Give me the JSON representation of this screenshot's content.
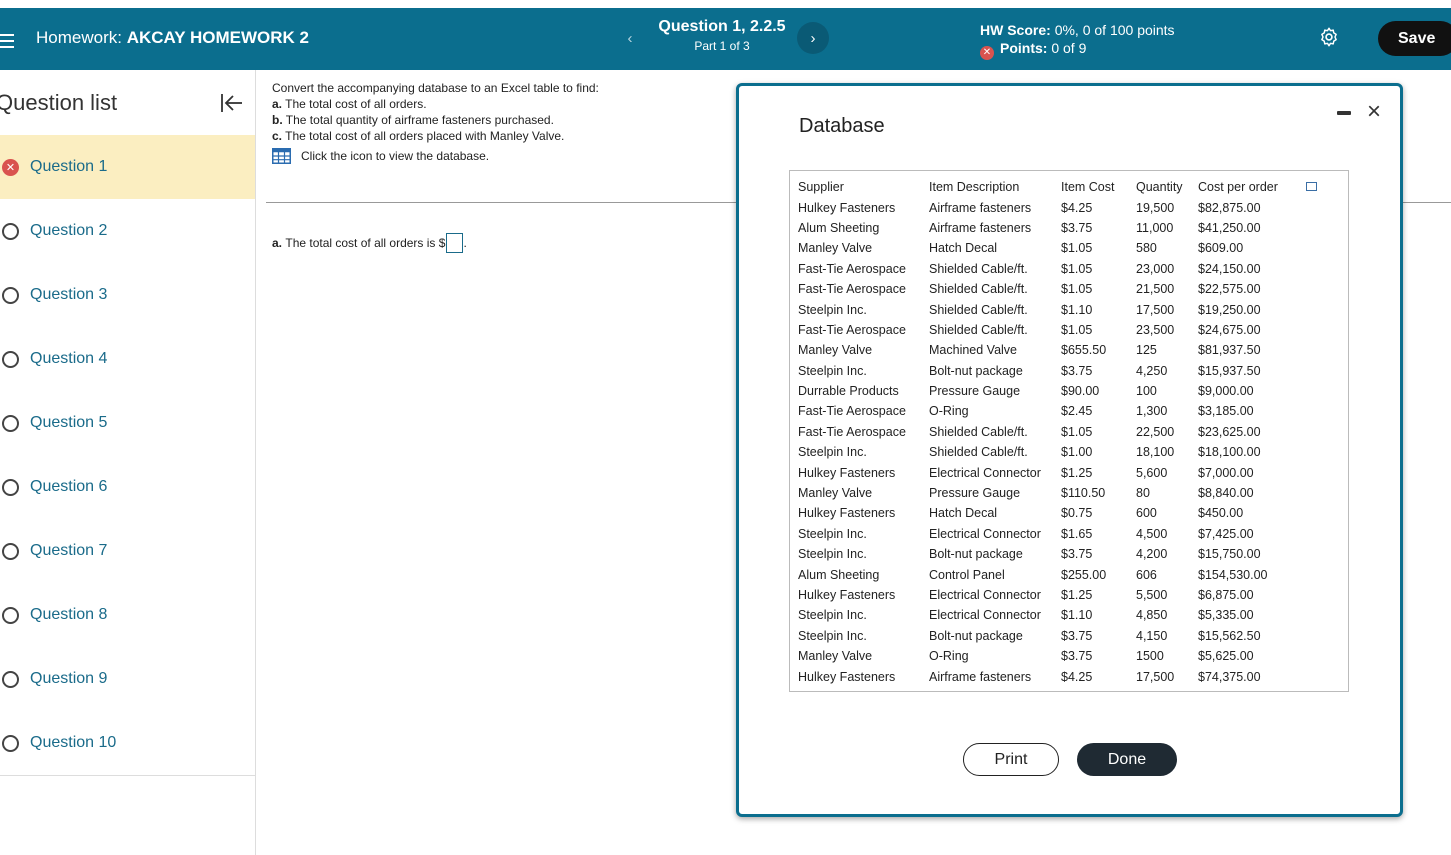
{
  "header": {
    "homework_prefix": "Homework:",
    "homework_name": "AKCAY HOMEWORK 2",
    "question_title": "Question 1, 2.2.5",
    "question_part": "Part 1 of 3",
    "prev_icon": "‹",
    "next_icon": "›",
    "hw_score_label": "HW Score:",
    "hw_score_value": "0%, 0 of 100 points",
    "points_label": "Points:",
    "points_value": "0 of 9",
    "save_label": "Save"
  },
  "sidebar": {
    "title": "Question list",
    "items": [
      {
        "label": "Question 1",
        "status": "incorrect"
      },
      {
        "label": "Question 2"
      },
      {
        "label": "Question 3"
      },
      {
        "label": "Question 4"
      },
      {
        "label": "Question 5"
      },
      {
        "label": "Question 6"
      },
      {
        "label": "Question 7"
      },
      {
        "label": "Question 8"
      },
      {
        "label": "Question 9"
      },
      {
        "label": "Question 10"
      }
    ]
  },
  "question": {
    "intro": "Convert the accompanying database to an Excel table to find:",
    "parts": [
      {
        "letter": "a.",
        "text": "The total cost of all orders."
      },
      {
        "letter": "b.",
        "text": "The total quantity of airframe fasteners purchased."
      },
      {
        "letter": "c.",
        "text": "The total cost of all orders placed with Manley Valve."
      }
    ],
    "db_link": "Click the icon to view the database.",
    "answer_letter": "a.",
    "answer_text": "The total cost of all orders is $",
    "answer_suffix": "."
  },
  "modal": {
    "title": "Database",
    "headers": [
      "Supplier",
      "Item Description",
      "Item Cost",
      "Quantity",
      "Cost per order"
    ],
    "rows": [
      [
        "Hulkey Fasteners",
        "Airframe fasteners",
        "$4.25",
        "19,500",
        "$82,875.00"
      ],
      [
        "Alum Sheeting",
        "Airframe fasteners",
        "$3.75",
        "11,000",
        "$41,250.00"
      ],
      [
        "Manley Valve",
        "Hatch Decal",
        "$1.05",
        "580",
        "$609.00"
      ],
      [
        "Fast-Tie Aerospace",
        "Shielded Cable/ft.",
        "$1.05",
        "23,000",
        "$24,150.00"
      ],
      [
        "Fast-Tie Aerospace",
        "Shielded Cable/ft.",
        "$1.05",
        "21,500",
        "$22,575.00"
      ],
      [
        "Steelpin Inc.",
        "Shielded Cable/ft.",
        "$1.10",
        "17,500",
        "$19,250.00"
      ],
      [
        "Fast-Tie Aerospace",
        "Shielded Cable/ft.",
        "$1.05",
        "23,500",
        "$24,675.00"
      ],
      [
        "Manley Valve",
        "Machined Valve",
        "$655.50",
        "125",
        "$81,937.50"
      ],
      [
        "Steelpin Inc.",
        "Bolt-nut package",
        "$3.75",
        "4,250",
        "$15,937.50"
      ],
      [
        "Durrable Products",
        "Pressure Gauge",
        "$90.00",
        "100",
        "$9,000.00"
      ],
      [
        "Fast-Tie Aerospace",
        "O-Ring",
        "$2.45",
        "1,300",
        "$3,185.00"
      ],
      [
        "Fast-Tie Aerospace",
        "Shielded Cable/ft.",
        "$1.05",
        "22,500",
        "$23,625.00"
      ],
      [
        "Steelpin Inc.",
        "Shielded Cable/ft.",
        "$1.00",
        "18,100",
        "$18,100.00"
      ],
      [
        "Hulkey Fasteners",
        "Electrical Connector",
        "$1.25",
        "5,600",
        "$7,000.00"
      ],
      [
        "Manley Valve",
        "Pressure Gauge",
        "$110.50",
        "80",
        "$8,840.00"
      ],
      [
        "Hulkey Fasteners",
        "Hatch Decal",
        "$0.75",
        "600",
        "$450.00"
      ],
      [
        "Steelpin Inc.",
        "Electrical Connector",
        "$1.65",
        "4,500",
        "$7,425.00"
      ],
      [
        "Steelpin Inc.",
        "Bolt-nut package",
        "$3.75",
        "4,200",
        "$15,750.00"
      ],
      [
        "Alum Sheeting",
        "Control Panel",
        "$255.00",
        "606",
        "$154,530.00"
      ],
      [
        "Hulkey Fasteners",
        "Electrical Connector",
        "$1.25",
        "5,500",
        "$6,875.00"
      ],
      [
        "Steelpin Inc.",
        "Electrical Connector",
        "$1.10",
        "4,850",
        "$5,335.00"
      ],
      [
        "Steelpin Inc.",
        "Bolt-nut package",
        "$3.75",
        "4,150",
        "$15,562.50"
      ],
      [
        "Manley Valve",
        "O-Ring",
        "$3.75",
        "1500",
        "$5,625.00"
      ],
      [
        "Hulkey Fasteners",
        "Airframe fasteners",
        "$4.25",
        "17,500",
        "$74,375.00"
      ]
    ],
    "print_label": "Print",
    "done_label": "Done",
    "close_icon": "×"
  },
  "colors": {
    "header_bg": "#0b6e8e",
    "active_question_bg": "#fbeec1",
    "link_color": "#1a6b8a",
    "error_red": "#d9534f"
  }
}
